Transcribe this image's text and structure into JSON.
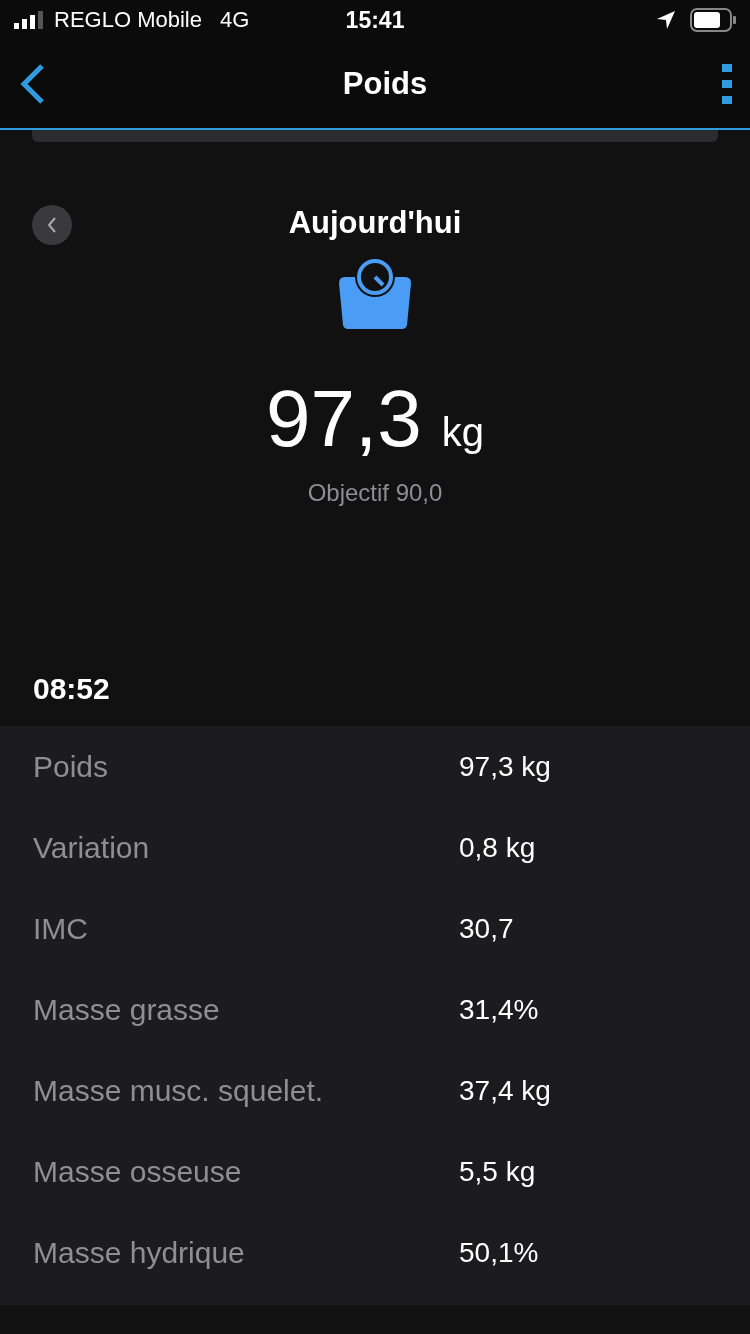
{
  "status_bar": {
    "carrier": "REGLO Mobile",
    "network": "4G",
    "time": "15:41"
  },
  "nav": {
    "title": "Poids"
  },
  "summary": {
    "date": "Aujourd'hui",
    "value": "97,3",
    "unit": "kg",
    "goal": "Objectif 90,0"
  },
  "entry": {
    "time": "08:52",
    "rows": [
      {
        "label": "Poids",
        "value": "97,3 kg"
      },
      {
        "label": "Variation",
        "value": "0,8 kg"
      },
      {
        "label": "IMC",
        "value": "30,7"
      },
      {
        "label": "Masse grasse",
        "value": "31,4%"
      },
      {
        "label": "Masse musc. squelet.",
        "value": "37,4 kg"
      },
      {
        "label": "Masse osseuse",
        "value": "5,5 kg"
      },
      {
        "label": "Masse hydrique",
        "value": "50,1%"
      }
    ]
  }
}
